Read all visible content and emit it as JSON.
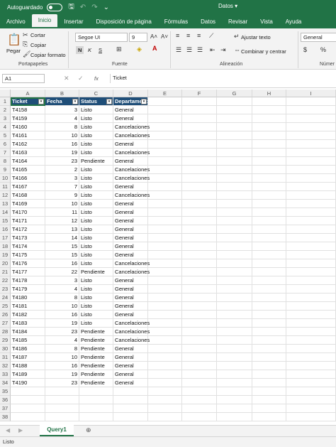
{
  "titlebar": {
    "autosave_label": "Autoguardado",
    "doc_name": "Datos",
    "doc_caret": "▾"
  },
  "tabs": [
    "Archivo",
    "Inicio",
    "Insertar",
    "Disposición de página",
    "Fórmulas",
    "Datos",
    "Revisar",
    "Vista",
    "Ayuda"
  ],
  "active_tab": "Inicio",
  "ribbon": {
    "clipboard": {
      "paste": "Pegar",
      "cut": "Cortar",
      "copy": "Copiar",
      "format_painter": "Copiar formato",
      "label": "Portapapeles"
    },
    "font": {
      "name": "Segoe UI",
      "size": "9",
      "bold": "N",
      "italic": "K",
      "underline": "S",
      "label": "Fuente"
    },
    "alignment": {
      "wrap_text": "Ajustar texto",
      "merge": "Combinar y centrar",
      "label": "Alineación"
    },
    "number": {
      "format": "General",
      "label": "Númer"
    }
  },
  "formula_bar": {
    "name_box": "A1",
    "fx": "fx",
    "value": "Ticket"
  },
  "columns": [
    "A",
    "B",
    "C",
    "D",
    "E",
    "F",
    "G",
    "H",
    "I"
  ],
  "table": {
    "headers": [
      "Ticket",
      "Fecha",
      "Status",
      "Departamento"
    ],
    "rows": [
      [
        "T4158",
        "3",
        "Listo",
        "General"
      ],
      [
        "T4159",
        "4",
        "Listo",
        "General"
      ],
      [
        "T4160",
        "8",
        "Listo",
        "Cancelaciones"
      ],
      [
        "T4161",
        "10",
        "Listo",
        "Cancelaciones"
      ],
      [
        "T4162",
        "16",
        "Listo",
        "General"
      ],
      [
        "T4163",
        "19",
        "Listo",
        "Cancelaciones"
      ],
      [
        "T4164",
        "23",
        "Pendiente",
        "General"
      ],
      [
        "T4165",
        "2",
        "Listo",
        "Cancelaciones"
      ],
      [
        "T4166",
        "3",
        "Listo",
        "Cancelaciones"
      ],
      [
        "T4167",
        "7",
        "Listo",
        "General"
      ],
      [
        "T4168",
        "9",
        "Listo",
        "Cancelaciones"
      ],
      [
        "T4169",
        "10",
        "Listo",
        "General"
      ],
      [
        "T4170",
        "11",
        "Listo",
        "General"
      ],
      [
        "T4171",
        "12",
        "Listo",
        "General"
      ],
      [
        "T4172",
        "13",
        "Listo",
        "General"
      ],
      [
        "T4173",
        "14",
        "Listo",
        "General"
      ],
      [
        "T4174",
        "15",
        "Listo",
        "General"
      ],
      [
        "T4175",
        "15",
        "Listo",
        "General"
      ],
      [
        "T4176",
        "16",
        "Listo",
        "Cancelaciones"
      ],
      [
        "T4177",
        "22",
        "Pendiente",
        "Cancelaciones"
      ],
      [
        "T4178",
        "3",
        "Listo",
        "General"
      ],
      [
        "T4179",
        "4",
        "Listo",
        "General"
      ],
      [
        "T4180",
        "8",
        "Listo",
        "General"
      ],
      [
        "T4181",
        "10",
        "Listo",
        "General"
      ],
      [
        "T4182",
        "16",
        "Listo",
        "General"
      ],
      [
        "T4183",
        "19",
        "Listo",
        "Cancelaciones"
      ],
      [
        "T4184",
        "23",
        "Pendiente",
        "Cancelaciones"
      ],
      [
        "T4185",
        "4",
        "Pendiente",
        "Cancelaciones"
      ],
      [
        "T4186",
        "8",
        "Pendiente",
        "General"
      ],
      [
        "T4187",
        "10",
        "Pendiente",
        "General"
      ],
      [
        "T4188",
        "16",
        "Pendiente",
        "General"
      ],
      [
        "T4189",
        "19",
        "Pendiente",
        "General"
      ],
      [
        "T4190",
        "23",
        "Pendiente",
        "General"
      ]
    ]
  },
  "row_numbers_count": 38,
  "sheet_tab": "Query1",
  "status": "Listo",
  "colors": {
    "excel_green": "#217346",
    "table_header": "#1f4e78"
  }
}
